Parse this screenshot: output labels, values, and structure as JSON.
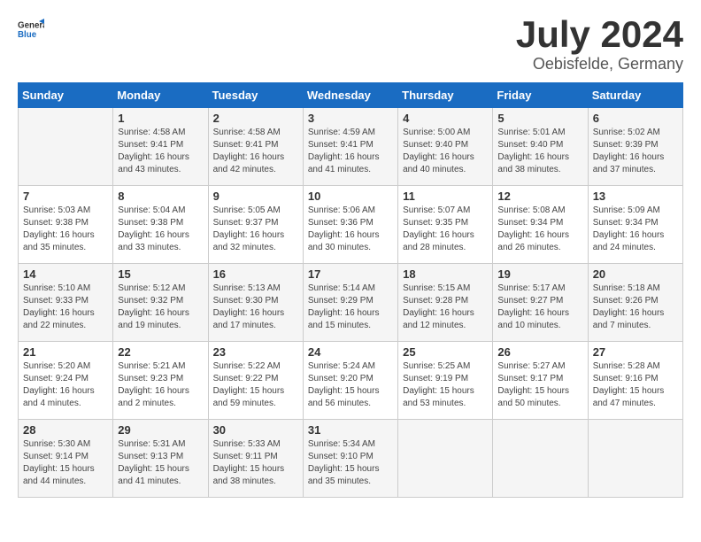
{
  "header": {
    "logo_general": "General",
    "logo_blue": "Blue",
    "month_year": "July 2024",
    "location": "Oebisfelde, Germany"
  },
  "weekdays": [
    "Sunday",
    "Monday",
    "Tuesday",
    "Wednesday",
    "Thursday",
    "Friday",
    "Saturday"
  ],
  "weeks": [
    [
      {
        "day": "",
        "sunrise": "",
        "sunset": "",
        "daylight": ""
      },
      {
        "day": "1",
        "sunrise": "Sunrise: 4:58 AM",
        "sunset": "Sunset: 9:41 PM",
        "daylight": "Daylight: 16 hours and 43 minutes."
      },
      {
        "day": "2",
        "sunrise": "Sunrise: 4:58 AM",
        "sunset": "Sunset: 9:41 PM",
        "daylight": "Daylight: 16 hours and 42 minutes."
      },
      {
        "day": "3",
        "sunrise": "Sunrise: 4:59 AM",
        "sunset": "Sunset: 9:41 PM",
        "daylight": "Daylight: 16 hours and 41 minutes."
      },
      {
        "day": "4",
        "sunrise": "Sunrise: 5:00 AM",
        "sunset": "Sunset: 9:40 PM",
        "daylight": "Daylight: 16 hours and 40 minutes."
      },
      {
        "day": "5",
        "sunrise": "Sunrise: 5:01 AM",
        "sunset": "Sunset: 9:40 PM",
        "daylight": "Daylight: 16 hours and 38 minutes."
      },
      {
        "day": "6",
        "sunrise": "Sunrise: 5:02 AM",
        "sunset": "Sunset: 9:39 PM",
        "daylight": "Daylight: 16 hours and 37 minutes."
      }
    ],
    [
      {
        "day": "7",
        "sunrise": "Sunrise: 5:03 AM",
        "sunset": "Sunset: 9:38 PM",
        "daylight": "Daylight: 16 hours and 35 minutes."
      },
      {
        "day": "8",
        "sunrise": "Sunrise: 5:04 AM",
        "sunset": "Sunset: 9:38 PM",
        "daylight": "Daylight: 16 hours and 33 minutes."
      },
      {
        "day": "9",
        "sunrise": "Sunrise: 5:05 AM",
        "sunset": "Sunset: 9:37 PM",
        "daylight": "Daylight: 16 hours and 32 minutes."
      },
      {
        "day": "10",
        "sunrise": "Sunrise: 5:06 AM",
        "sunset": "Sunset: 9:36 PM",
        "daylight": "Daylight: 16 hours and 30 minutes."
      },
      {
        "day": "11",
        "sunrise": "Sunrise: 5:07 AM",
        "sunset": "Sunset: 9:35 PM",
        "daylight": "Daylight: 16 hours and 28 minutes."
      },
      {
        "day": "12",
        "sunrise": "Sunrise: 5:08 AM",
        "sunset": "Sunset: 9:34 PM",
        "daylight": "Daylight: 16 hours and 26 minutes."
      },
      {
        "day": "13",
        "sunrise": "Sunrise: 5:09 AM",
        "sunset": "Sunset: 9:34 PM",
        "daylight": "Daylight: 16 hours and 24 minutes."
      }
    ],
    [
      {
        "day": "14",
        "sunrise": "Sunrise: 5:10 AM",
        "sunset": "Sunset: 9:33 PM",
        "daylight": "Daylight: 16 hours and 22 minutes."
      },
      {
        "day": "15",
        "sunrise": "Sunrise: 5:12 AM",
        "sunset": "Sunset: 9:32 PM",
        "daylight": "Daylight: 16 hours and 19 minutes."
      },
      {
        "day": "16",
        "sunrise": "Sunrise: 5:13 AM",
        "sunset": "Sunset: 9:30 PM",
        "daylight": "Daylight: 16 hours and 17 minutes."
      },
      {
        "day": "17",
        "sunrise": "Sunrise: 5:14 AM",
        "sunset": "Sunset: 9:29 PM",
        "daylight": "Daylight: 16 hours and 15 minutes."
      },
      {
        "day": "18",
        "sunrise": "Sunrise: 5:15 AM",
        "sunset": "Sunset: 9:28 PM",
        "daylight": "Daylight: 16 hours and 12 minutes."
      },
      {
        "day": "19",
        "sunrise": "Sunrise: 5:17 AM",
        "sunset": "Sunset: 9:27 PM",
        "daylight": "Daylight: 16 hours and 10 minutes."
      },
      {
        "day": "20",
        "sunrise": "Sunrise: 5:18 AM",
        "sunset": "Sunset: 9:26 PM",
        "daylight": "Daylight: 16 hours and 7 minutes."
      }
    ],
    [
      {
        "day": "21",
        "sunrise": "Sunrise: 5:20 AM",
        "sunset": "Sunset: 9:24 PM",
        "daylight": "Daylight: 16 hours and 4 minutes."
      },
      {
        "day": "22",
        "sunrise": "Sunrise: 5:21 AM",
        "sunset": "Sunset: 9:23 PM",
        "daylight": "Daylight: 16 hours and 2 minutes."
      },
      {
        "day": "23",
        "sunrise": "Sunrise: 5:22 AM",
        "sunset": "Sunset: 9:22 PM",
        "daylight": "Daylight: 15 hours and 59 minutes."
      },
      {
        "day": "24",
        "sunrise": "Sunrise: 5:24 AM",
        "sunset": "Sunset: 9:20 PM",
        "daylight": "Daylight: 15 hours and 56 minutes."
      },
      {
        "day": "25",
        "sunrise": "Sunrise: 5:25 AM",
        "sunset": "Sunset: 9:19 PM",
        "daylight": "Daylight: 15 hours and 53 minutes."
      },
      {
        "day": "26",
        "sunrise": "Sunrise: 5:27 AM",
        "sunset": "Sunset: 9:17 PM",
        "daylight": "Daylight: 15 hours and 50 minutes."
      },
      {
        "day": "27",
        "sunrise": "Sunrise: 5:28 AM",
        "sunset": "Sunset: 9:16 PM",
        "daylight": "Daylight: 15 hours and 47 minutes."
      }
    ],
    [
      {
        "day": "28",
        "sunrise": "Sunrise: 5:30 AM",
        "sunset": "Sunset: 9:14 PM",
        "daylight": "Daylight: 15 hours and 44 minutes."
      },
      {
        "day": "29",
        "sunrise": "Sunrise: 5:31 AM",
        "sunset": "Sunset: 9:13 PM",
        "daylight": "Daylight: 15 hours and 41 minutes."
      },
      {
        "day": "30",
        "sunrise": "Sunrise: 5:33 AM",
        "sunset": "Sunset: 9:11 PM",
        "daylight": "Daylight: 15 hours and 38 minutes."
      },
      {
        "day": "31",
        "sunrise": "Sunrise: 5:34 AM",
        "sunset": "Sunset: 9:10 PM",
        "daylight": "Daylight: 15 hours and 35 minutes."
      },
      {
        "day": "",
        "sunrise": "",
        "sunset": "",
        "daylight": ""
      },
      {
        "day": "",
        "sunrise": "",
        "sunset": "",
        "daylight": ""
      },
      {
        "day": "",
        "sunrise": "",
        "sunset": "",
        "daylight": ""
      }
    ]
  ]
}
